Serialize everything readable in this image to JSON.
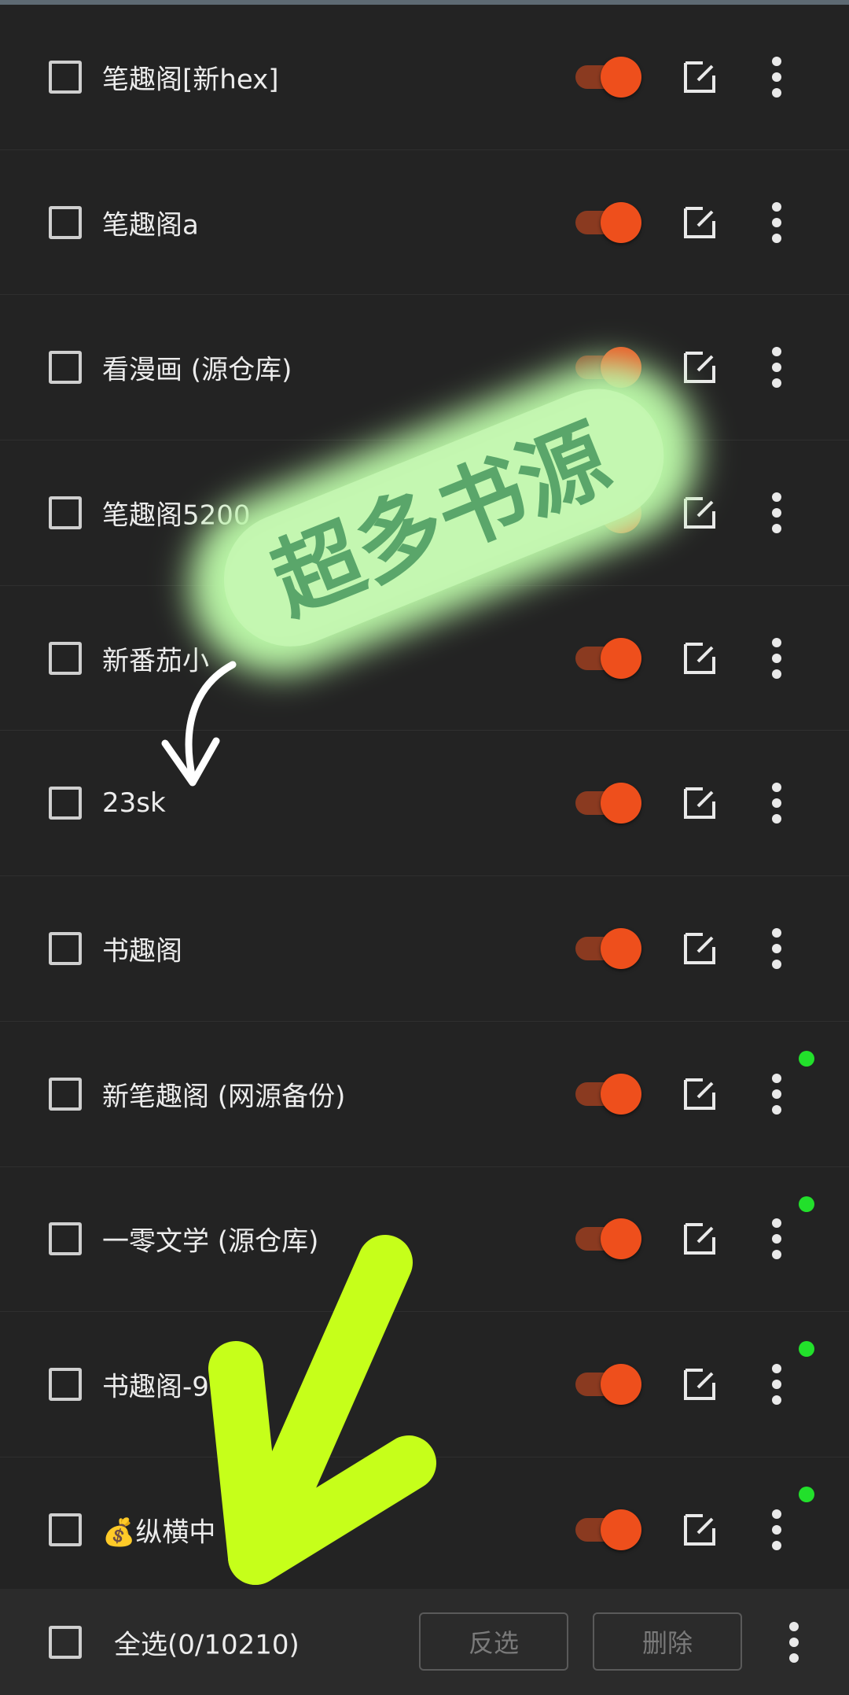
{
  "items": [
    {
      "name": "笔趣阁[新hex]",
      "enabled": true,
      "dot": false
    },
    {
      "name": "笔趣阁a",
      "enabled": true,
      "dot": false
    },
    {
      "name": "看漫画 (源仓库)",
      "enabled": true,
      "dot": false
    },
    {
      "name": "笔趣阁5200",
      "enabled": true,
      "dot": false
    },
    {
      "name": "新番茄小",
      "enabled": true,
      "dot": false
    },
    {
      "name": "23sk",
      "enabled": true,
      "dot": false
    },
    {
      "name": "书趣阁",
      "enabled": true,
      "dot": false
    },
    {
      "name": "新笔趣阁 (网源备份)",
      "enabled": true,
      "dot": true
    },
    {
      "name": "一零文学 (源仓库)",
      "enabled": true,
      "dot": true
    },
    {
      "name": "书趣阁-9",
      "enabled": true,
      "dot": true
    },
    {
      "name": "💰纵横中",
      "enabled": true,
      "dot": true
    }
  ],
  "bottom_bar": {
    "select_all": "全选(0/10210)",
    "invert": "反选",
    "delete": "删除"
  },
  "overlay": {
    "banner_text": "超多书源",
    "banner_color": "#b9f5a6",
    "banner_text_color": "#5aa66a",
    "arrow_color": "#c6ff1a"
  },
  "colors": {
    "toggle_thumb": "#ee4f1c",
    "toggle_track": "#8a3a20",
    "status_dot": "#22e02b",
    "background": "#232323"
  }
}
